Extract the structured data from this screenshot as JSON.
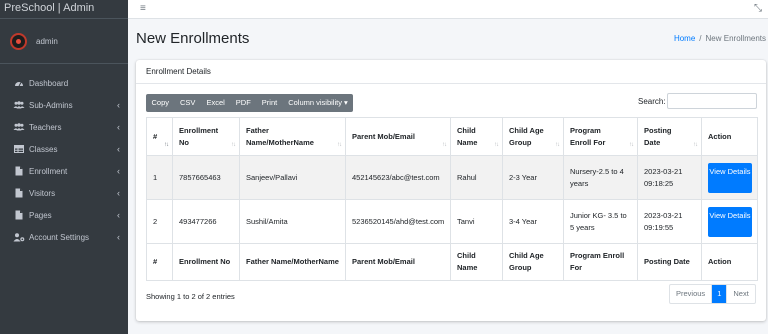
{
  "app": {
    "brand": "PreSchool | Admin",
    "user": "admin"
  },
  "sidebar": {
    "items": [
      {
        "label": "Dashboard",
        "icon": "dashboard-icon",
        "chevron": false
      },
      {
        "label": "Sub-Admins",
        "icon": "users-icon",
        "chevron": true
      },
      {
        "label": "Teachers",
        "icon": "users-icon",
        "chevron": true
      },
      {
        "label": "Classes",
        "icon": "table-icon",
        "chevron": true
      },
      {
        "label": "Enrollment",
        "icon": "file-icon",
        "chevron": true
      },
      {
        "label": "Visitors",
        "icon": "file-icon",
        "chevron": true
      },
      {
        "label": "Pages",
        "icon": "file-icon",
        "chevron": true
      },
      {
        "label": "Account Settings",
        "icon": "user-cog-icon",
        "chevron": true
      }
    ]
  },
  "topbar": {
    "menu_icon": "≡",
    "expand_icon": "⤡"
  },
  "header": {
    "title": "New Enrollments"
  },
  "breadcrumb": {
    "home": "Home",
    "separator": "/",
    "current": "New Enrollments"
  },
  "card": {
    "title": "Enrollment Details"
  },
  "toolbar": {
    "copy": "Copy",
    "csv": "CSV",
    "excel": "Excel",
    "pdf": "PDF",
    "print": "Print",
    "colvis": "Column visibility ▾"
  },
  "search": {
    "label": "Search:",
    "value": ""
  },
  "table": {
    "headers": [
      "#",
      "Enrollment No",
      "Father Name/MotherName",
      "Parent Mob/Email",
      "Child Name",
      "Child Age Group",
      "Program Enroll For",
      "Posting Date",
      "Action"
    ],
    "rows": [
      {
        "num": "1",
        "enroll": "7857665463",
        "parents": "Sanjeev/Pallavi",
        "contact": "452145623/abc@test.com",
        "child": "Rahul",
        "age": "2-3 Year",
        "program": "Nursery-2.5 to 4 years",
        "date": "2023-03-21 09:18:25",
        "action": "View Details"
      },
      {
        "num": "2",
        "enroll": "493477266",
        "parents": "Sushil/Amita",
        "contact": "5236520145/ahd@test.com",
        "child": "Tanvi",
        "age": "3-4 Year",
        "program": "Junior KG- 3.5 to 5 years",
        "date": "2023-03-21 09:19:55",
        "action": "View Details"
      }
    ],
    "footer": [
      "#",
      "Enrollment No",
      "Father Name/MotherName",
      "Parent Mob/Email",
      "Child Name",
      "Child Age Group",
      "Program Enroll For",
      "Posting Date",
      "Action"
    ]
  },
  "info": "Showing 1 to 2 of 2 entries",
  "pagination": {
    "previous": "Previous",
    "current": "1",
    "next": "Next"
  },
  "colors": {
    "sidebar_bg": "#343a40",
    "primary": "#007bff",
    "secondary": "#6c757d"
  }
}
